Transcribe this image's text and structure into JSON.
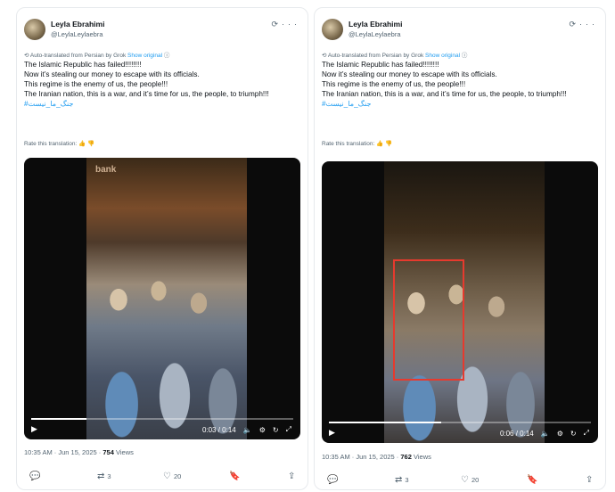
{
  "posts": [
    {
      "author_name": "Leyla Ebrahimi",
      "author_handle": "@LeylaLeylaebra",
      "header_icons": [
        "grok-icon",
        "more-icon"
      ],
      "auto_translated": "Auto-translated from Persian by Grok",
      "show_original": "Show original",
      "lines": [
        "The Islamic Republic has failed!!!!!!!!",
        "Now it’s stealing our money to escape with its officials.",
        "This regime is the enemy of us, the people!!!",
        "The Iranian nation, this is a war, and it’s time for us, the people, to triumph!!!"
      ],
      "hashtag": "#جنگ_ما_نیست",
      "rate": "Rate this translation:",
      "video": {
        "time": "0:03 / 0:14",
        "progress": 0.21,
        "sign": "bank",
        "highlight": false
      },
      "meta_time": "10:35 AM · Jun 15, 2025 · ",
      "views_count": "754",
      "views_label": "Views",
      "retweets": "3",
      "likes": "20"
    },
    {
      "author_name": "Leyla Ebrahimi",
      "author_handle": "@LeylaLeylaebra",
      "header_icons": [
        "grok-icon",
        "more-icon"
      ],
      "auto_translated": "Auto-translated from Persian by Grok",
      "show_original": "Show original",
      "lines": [
        "The Islamic Republic has failed!!!!!!!!",
        "Now it’s stealing our money to escape with its officials.",
        "This regime is the enemy of us, the people!!!",
        "The Iranian nation, this is a war, and it’s time for us, the people, to triumph!!!"
      ],
      "hashtag": "#جنگ_ما_نیست",
      "rate": "Rate this translation:",
      "video": {
        "time": "0:06 / 0:14",
        "progress": 0.43,
        "sign": "",
        "highlight": true
      },
      "meta_time": "10:35 AM · Jun 15, 2025 · ",
      "views_count": "762",
      "views_label": "Views",
      "retweets": "3",
      "likes": "20"
    }
  ]
}
